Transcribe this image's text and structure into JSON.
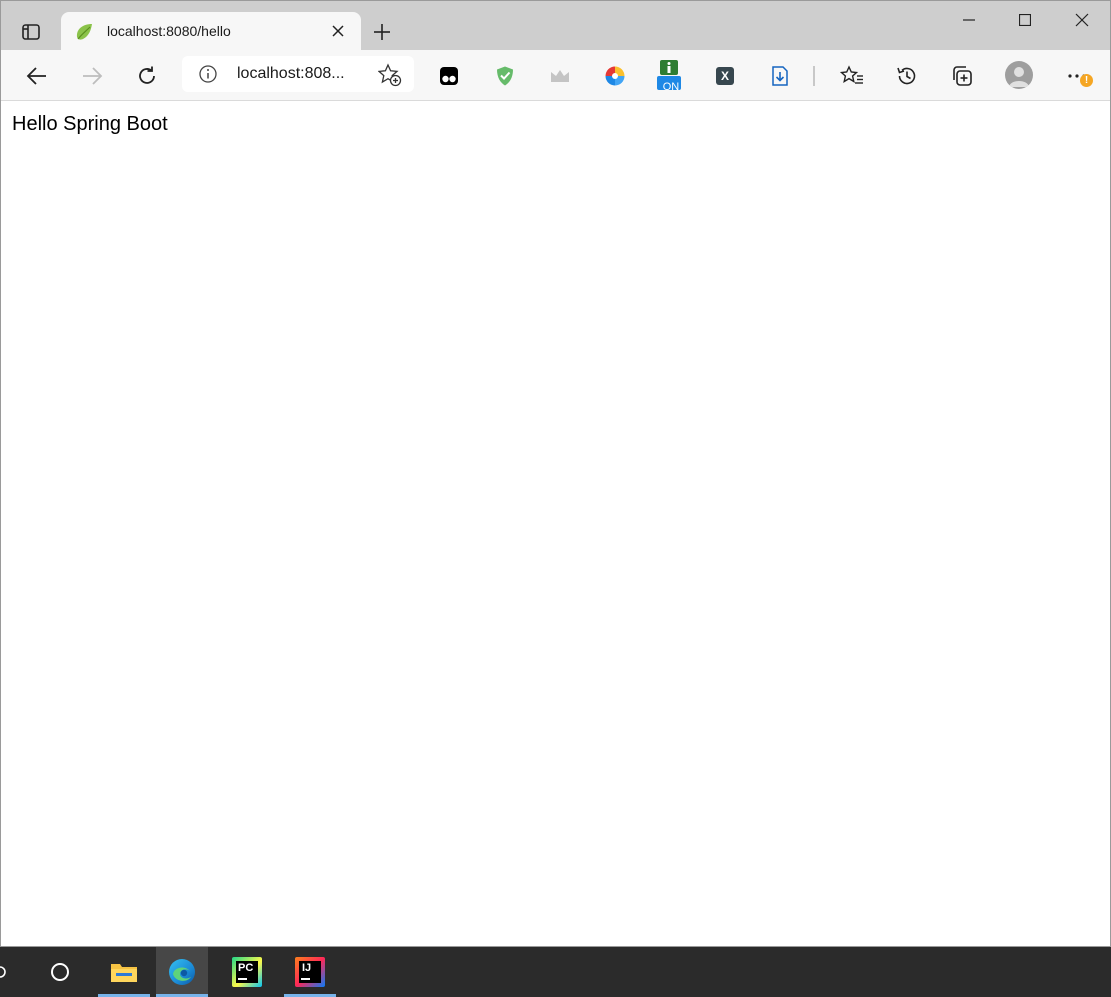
{
  "browser": {
    "tab": {
      "title": "localhost:8080/hello"
    },
    "address": {
      "display": "localhost:808..."
    },
    "toolbar": {
      "extensions": [
        "tampermonkey-icon",
        "adguard-shield-icon",
        "crown-icon",
        "color-wheel-icon",
        "info-on-icon",
        "x-extension-icon",
        "download-extension-icon"
      ],
      "extension_on_badge": "ON",
      "extension_x_label": "X"
    },
    "more_badge": "!"
  },
  "page": {
    "text": "Hello Spring Boot"
  },
  "taskbar": {
    "apps": [
      {
        "name": "File Explorer",
        "icon": "folder-icon"
      },
      {
        "name": "Microsoft Edge",
        "icon": "edge-icon"
      },
      {
        "name": "PyCharm",
        "icon": "pycharm-icon",
        "label": "PC"
      },
      {
        "name": "IntelliJ IDEA",
        "icon": "intellij-icon",
        "label": "IJ"
      }
    ]
  },
  "colors": {
    "titlebar": "#cecece",
    "toolbar": "#f7f7f7",
    "taskbar": "#2b2b2b",
    "taskbar_underline": "#77b3ea"
  }
}
